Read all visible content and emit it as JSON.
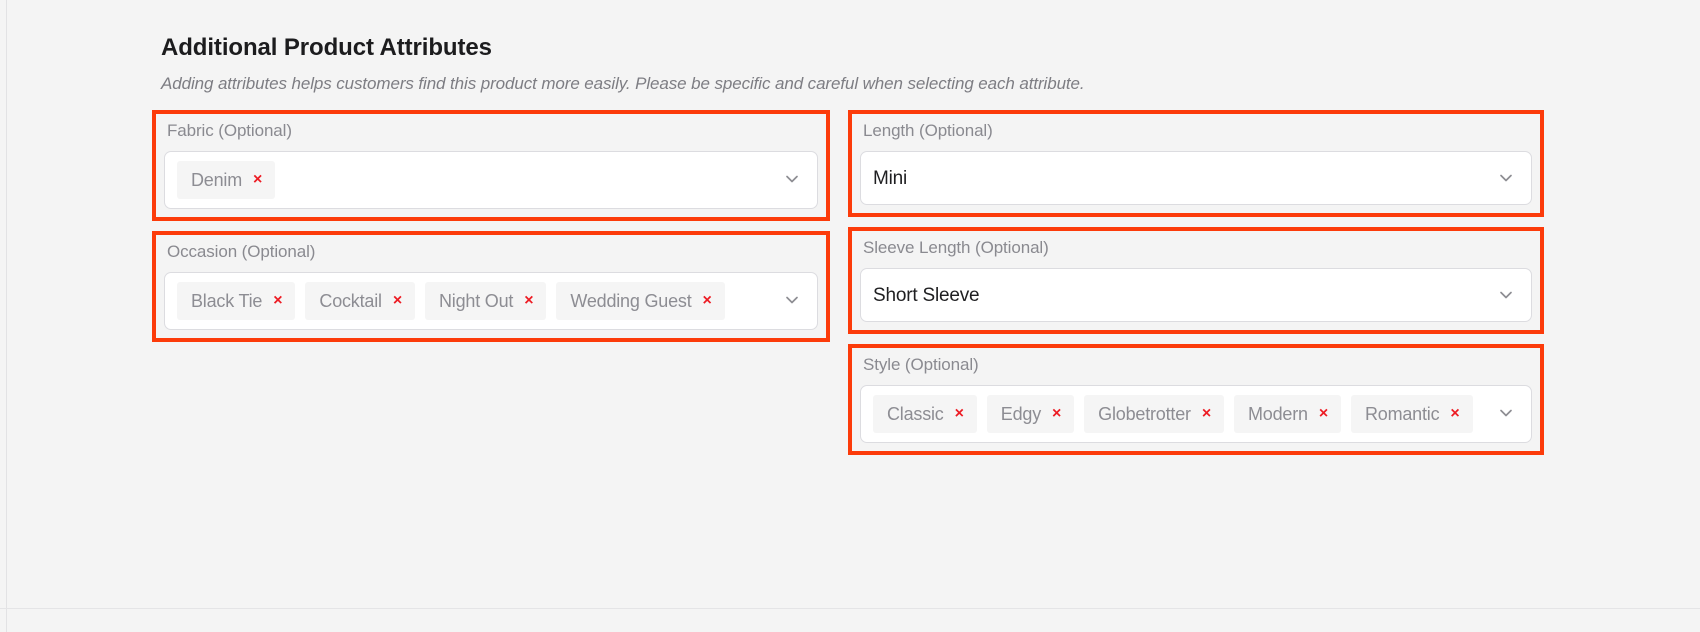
{
  "header": {
    "title": "Additional Product Attributes",
    "subtitle": "Adding attributes helps customers find this product more easily. Please be specific and careful when selecting each attribute."
  },
  "icons": {
    "chevron_down": "chevron-down-icon",
    "chip_remove": "×"
  },
  "colors": {
    "highlight": "#fc3b0a",
    "chip_bg": "#f5f5f5",
    "chip_text": "#8d8d93",
    "chip_remove": "#ed1c24",
    "page_bg": "#f4f4f4",
    "control_bg": "#ffffff",
    "control_border": "#dcdce0",
    "label_text": "#8a8a90",
    "value_text": "#1f1f21"
  },
  "fields": {
    "fabric": {
      "label": "Fabric (Optional)",
      "type": "multiselect",
      "highlighted": true,
      "chips": [
        "Denim"
      ]
    },
    "length": {
      "label": "Length (Optional)",
      "type": "select",
      "highlighted": true,
      "value": "Mini"
    },
    "occasion": {
      "label": "Occasion (Optional)",
      "type": "multiselect",
      "highlighted": true,
      "chips": [
        "Black Tie",
        "Cocktail",
        "Night Out",
        "Wedding Guest"
      ]
    },
    "sleeve_length": {
      "label": "Sleeve Length (Optional)",
      "type": "select",
      "highlighted": true,
      "value": "Short Sleeve"
    },
    "style": {
      "label": "Style (Optional)",
      "type": "multiselect",
      "highlighted": true,
      "chips": [
        "Classic",
        "Edgy",
        "Globetrotter",
        "Modern",
        "Romantic"
      ]
    }
  }
}
